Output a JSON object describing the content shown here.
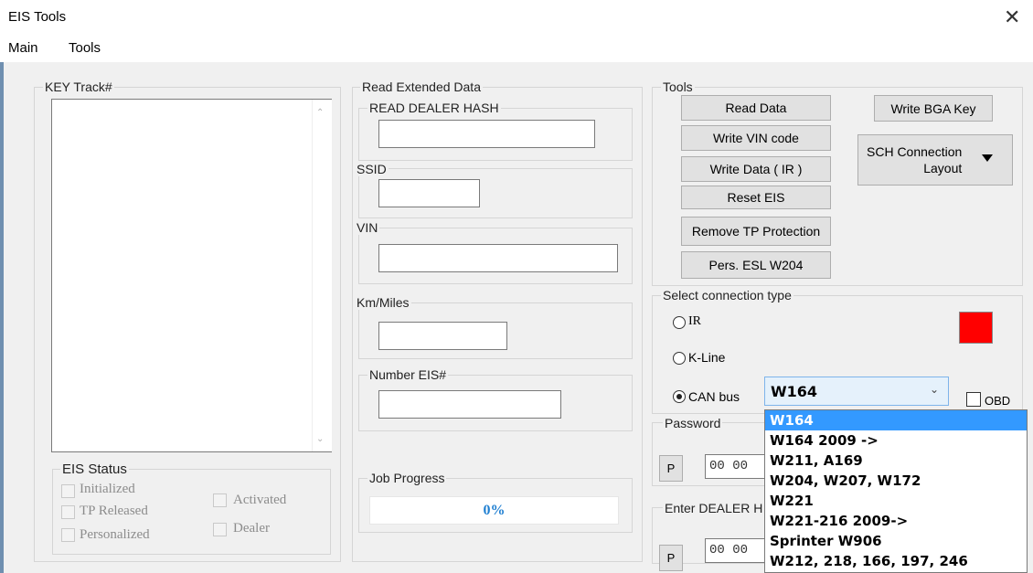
{
  "window": {
    "title": "EIS Tools",
    "close_glyph": "✕"
  },
  "menu": [
    "Main",
    "Tools"
  ],
  "key_track": {
    "label": "KEY Track#"
  },
  "eis_status": {
    "label": "EIS Status",
    "items": [
      "Initialized",
      "TP Released",
      "Personalized",
      "Activated",
      "Dealer"
    ]
  },
  "read_extended": {
    "label": "Read Extended Data",
    "dealer_hash": "READ DEALER HASH",
    "ssid": "SSID",
    "vin": "VIN",
    "km": "Km/Miles",
    "number_eis": "Number EIS#"
  },
  "job": {
    "label": "Job Progress",
    "progress_text": "0%",
    "progress": 0
  },
  "tools": {
    "label": "Tools",
    "buttons": [
      "Read Data",
      "Write VIN code",
      "Write Data ( IR )",
      "Reset EIS",
      "Remove TP Protection",
      "Pers. ESL W204"
    ],
    "write_bga": "Write BGA Key",
    "sch_line1": "SCH Connection",
    "sch_line2": "Layout"
  },
  "connection": {
    "label": "Select connection type",
    "options": [
      "IR",
      "K-Line",
      "CAN bus"
    ],
    "selected": "CAN bus",
    "indicator_color": "#ff0000",
    "model_selected": "W164",
    "obd_label": "OBD"
  },
  "password": {
    "label": "Password",
    "p_label": "P",
    "value": "00 00"
  },
  "dealer": {
    "label": "Enter DEALER H",
    "p_label": "P",
    "value": "00 00"
  },
  "dropdown_options": [
    "W164",
    "W164 2009 ->",
    "W211, A169",
    "W204, W207, W172",
    "W221",
    "W221-216 2009->",
    "Sprinter W906",
    "W212, 218, 166, 197, 246"
  ]
}
